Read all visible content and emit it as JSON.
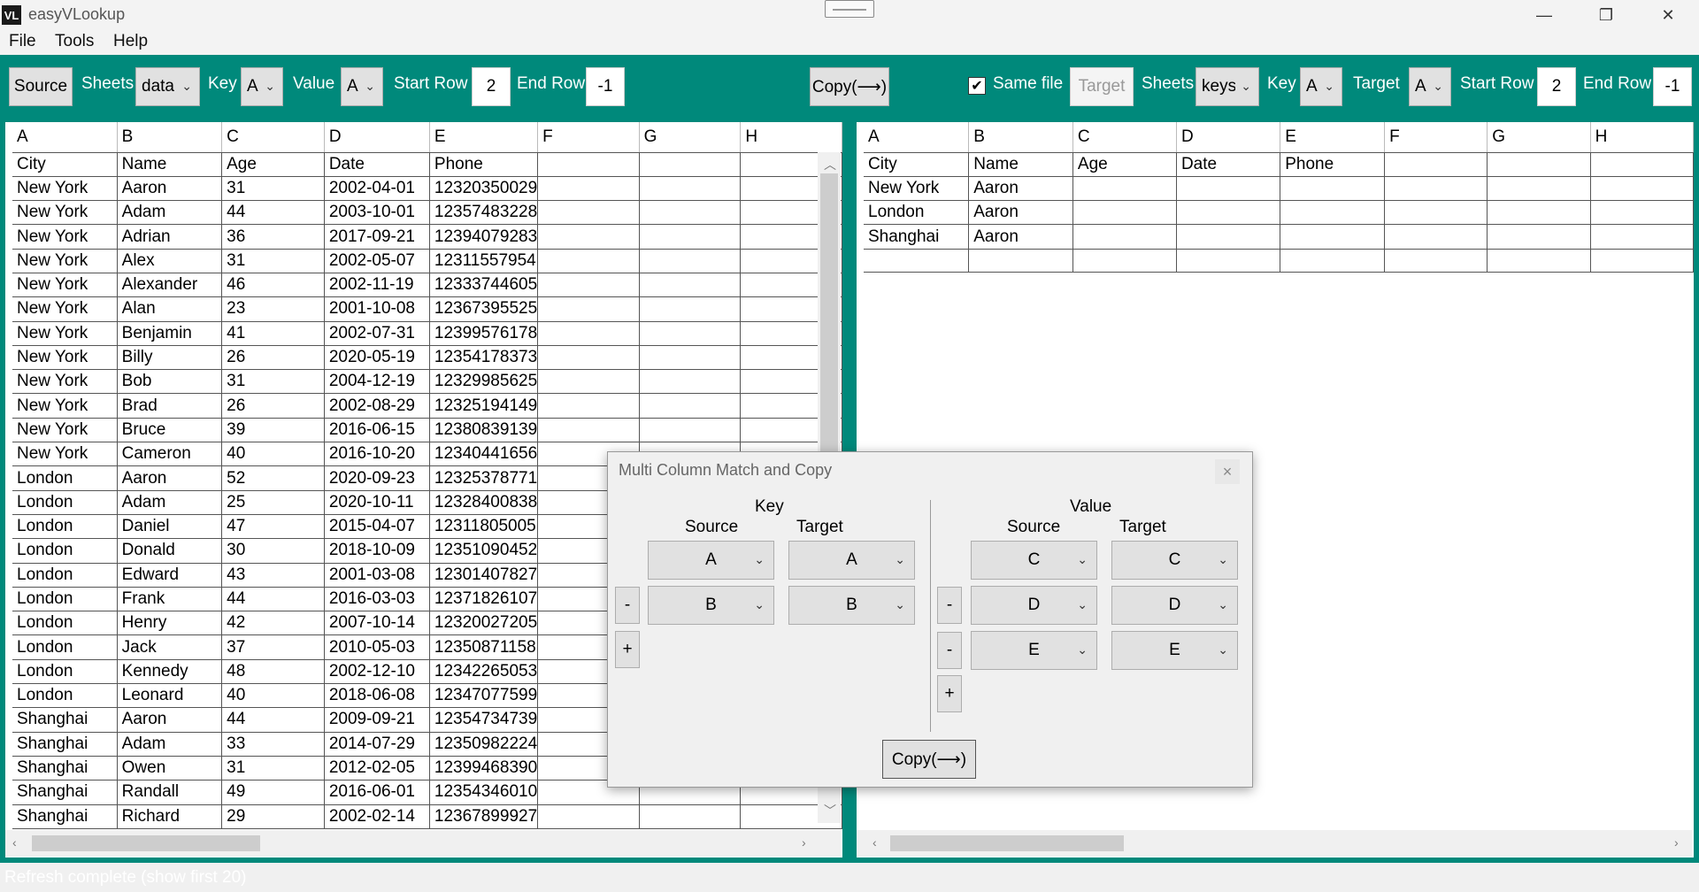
{
  "app": {
    "icon_text": "VL",
    "title": "easyVLookup",
    "minimize_glyph": "—",
    "restore_glyph": "❐",
    "close_glyph": "✕"
  },
  "menu": [
    "File",
    "Tools",
    "Help"
  ],
  "toolbar": {
    "source_button": "Source",
    "sheets_label": "Sheets",
    "source_sheet": "data",
    "key_label": "Key",
    "source_key": "A",
    "value_label": "Value",
    "source_value": "A",
    "start_row_label": "Start Row",
    "source_start_row": "2",
    "end_row_label": "End Row",
    "source_end_row": "-1",
    "copy_button": "Copy(⟶)",
    "same_file_label": "Same file",
    "same_file_checked": true,
    "target_button": "Target",
    "target_sheets_label": "Sheets",
    "target_sheet": "keys",
    "target_key_label": "Key",
    "target_key": "A",
    "target_label": "Target",
    "target_col": "A",
    "target_start_row_label": "Start Row",
    "target_start_row": "2",
    "target_end_row_label": "End Row",
    "target_end_row": "-1"
  },
  "source_grid": {
    "columns": [
      "A",
      "B",
      "C",
      "D",
      "E",
      "F",
      "G",
      "H"
    ],
    "rows": [
      [
        "City",
        "Name",
        "Age",
        "Date",
        "Phone",
        "",
        "",
        ""
      ],
      [
        "New York",
        "Aaron",
        "31",
        "2002-04-01",
        "12320350029",
        "",
        "",
        ""
      ],
      [
        "New York",
        "Adam",
        "44",
        "2003-10-01",
        "12357483228",
        "",
        "",
        ""
      ],
      [
        "New York",
        "Adrian",
        "36",
        "2017-09-21",
        "12394079283",
        "",
        "",
        ""
      ],
      [
        "New York",
        "Alex",
        "31",
        "2002-05-07",
        "12311557954",
        "",
        "",
        ""
      ],
      [
        "New York",
        "Alexander",
        "46",
        "2002-11-19",
        "12333744605",
        "",
        "",
        ""
      ],
      [
        "New York",
        "Alan",
        "23",
        "2001-10-08",
        "12367395525",
        "",
        "",
        ""
      ],
      [
        "New York",
        "Benjamin",
        "41",
        "2002-07-31",
        "12399576178",
        "",
        "",
        ""
      ],
      [
        "New York",
        "Billy",
        "26",
        "2020-05-19",
        "12354178373",
        "",
        "",
        ""
      ],
      [
        "New York",
        "Bob",
        "31",
        "2004-12-19",
        "12329985625",
        "",
        "",
        ""
      ],
      [
        "New York",
        "Brad",
        "26",
        "2002-08-29",
        "12325194149",
        "",
        "",
        ""
      ],
      [
        "New York",
        "Bruce",
        "39",
        "2016-06-15",
        "12380839139",
        "",
        "",
        ""
      ],
      [
        "New York",
        "Cameron",
        "40",
        "2016-10-20",
        "12340441656",
        "",
        "",
        ""
      ],
      [
        "London",
        "Aaron",
        "52",
        "2020-09-23",
        "12325378771",
        "",
        "",
        ""
      ],
      [
        "London",
        "Adam",
        "25",
        "2020-10-11",
        "12328400838",
        "",
        "",
        ""
      ],
      [
        "London",
        "Daniel",
        "47",
        "2015-04-07",
        "12311805005",
        "",
        "",
        ""
      ],
      [
        "London",
        "Donald",
        "30",
        "2018-10-09",
        "12351090452",
        "",
        "",
        ""
      ],
      [
        "London",
        "Edward",
        "43",
        "2001-03-08",
        "12301407827",
        "",
        "",
        ""
      ],
      [
        "London",
        "Frank",
        "44",
        "2016-03-03",
        "12371826107",
        "",
        "",
        ""
      ],
      [
        "London",
        "Henry",
        "42",
        "2007-10-14",
        "12320027205",
        "",
        "",
        ""
      ],
      [
        "London",
        "Jack",
        "37",
        "2010-05-03",
        "12350871158",
        "",
        "",
        ""
      ],
      [
        "London",
        "Kennedy",
        "48",
        "2002-12-10",
        "12342265053",
        "",
        "",
        ""
      ],
      [
        "London",
        "Leonard",
        "40",
        "2018-06-08",
        "12347077599",
        "",
        "",
        ""
      ],
      [
        "Shanghai",
        "Aaron",
        "44",
        "2009-09-21",
        "12354734739",
        "",
        "",
        ""
      ],
      [
        "Shanghai",
        "Adam",
        "33",
        "2014-07-29",
        "12350982224",
        "",
        "",
        ""
      ],
      [
        "Shanghai",
        "Owen",
        "31",
        "2012-02-05",
        "12399468390",
        "",
        "",
        ""
      ],
      [
        "Shanghai",
        "Randall",
        "49",
        "2016-06-01",
        "12354346010",
        "",
        "",
        ""
      ],
      [
        "Shanghai",
        "Richard",
        "29",
        "2002-02-14",
        "12367899927",
        "",
        "",
        ""
      ]
    ]
  },
  "target_grid": {
    "columns": [
      "A",
      "B",
      "C",
      "D",
      "E",
      "F",
      "G",
      "H"
    ],
    "rows": [
      [
        "City",
        "Name",
        "Age",
        "Date",
        "Phone",
        "",
        "",
        ""
      ],
      [
        "New York",
        "Aaron",
        "",
        "",
        "",
        "",
        "",
        ""
      ],
      [
        "London",
        "Aaron",
        "",
        "",
        "",
        "",
        "",
        ""
      ],
      [
        "Shanghai",
        "Aaron",
        "",
        "",
        "",
        "",
        "",
        ""
      ],
      [
        "",
        "",
        "",
        "",
        "",
        "",
        "",
        ""
      ]
    ]
  },
  "status": "Refresh complete (show first 20)",
  "dialog": {
    "title": "Multi Column Match and Copy",
    "close_glyph": "×",
    "key_header": "Key",
    "value_header": "Value",
    "source_label": "Source",
    "target_label": "Target",
    "key_rows": [
      {
        "source": "A",
        "target": "A"
      },
      {
        "source": "B",
        "target": "B"
      }
    ],
    "value_rows": [
      {
        "source": "C",
        "target": "C"
      },
      {
        "source": "D",
        "target": "D"
      },
      {
        "source": "E",
        "target": "E"
      }
    ],
    "minus": "-",
    "plus": "+",
    "copy_button": "Copy(⟶)"
  },
  "icons": {
    "chevron": "chevron-down-icon",
    "checkbox": "check-icon"
  },
  "colors": {
    "accent": "#00897b"
  }
}
